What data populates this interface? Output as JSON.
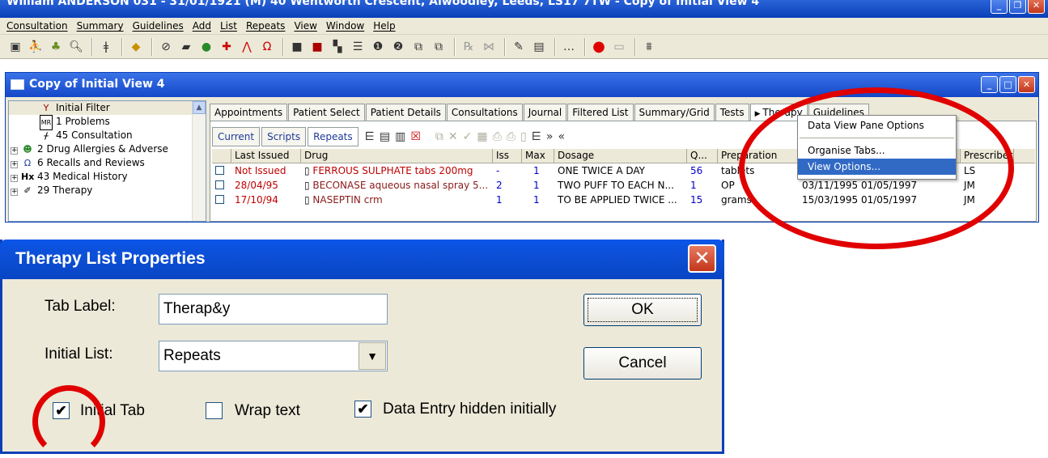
{
  "app": {
    "title": "William ANDERSON 031 - 31/01/1921 (M) 40 Wentworth Crescent, Alwoodley, Leeds, LS17 7TW - Copy of Initial View 4"
  },
  "menu": [
    "Consultation",
    "Summary",
    "Guidelines",
    "Add",
    "List",
    "Repeats",
    "View",
    "Window",
    "Help"
  ],
  "child_window": {
    "title": "Copy of Initial View 4",
    "tree": [
      {
        "label": "Initial Filter",
        "icon": "filter-icon"
      },
      {
        "label": "1 Problems",
        "icon": "problems-icon"
      },
      {
        "label": "45 Consultation",
        "icon": "consultation-icon"
      },
      {
        "label": "2 Drug Allergies & Adverse",
        "icon": "allergy-icon"
      },
      {
        "label": "6 Recalls and Reviews",
        "icon": "recall-icon"
      },
      {
        "label": "43 Medical History",
        "icon": "history-icon"
      },
      {
        "label": "29 Therapy",
        "icon": "therapy-icon"
      }
    ],
    "tabs": [
      "Appointments",
      "Patient Select",
      "Patient Details",
      "Consultations",
      "Journal",
      "Filtered List",
      "Summary/Grid",
      "Tests",
      "Therapy",
      "Guidelines"
    ],
    "subtabs": [
      "Current",
      "Scripts",
      "Repeats"
    ],
    "grid": {
      "headers": [
        "Last Issued",
        "Drug",
        "Iss",
        "Max",
        "Dosage",
        "Q...",
        "Preparation",
        "",
        "Prescriber"
      ],
      "rows": [
        {
          "last_issued": "Not Issued",
          "drug": "FERROUS SULPHATE tabs 200mg",
          "iss": "-",
          "max": "1",
          "dosage": "ONE TWICE A DAY",
          "q": "56",
          "prep": "tablets",
          "dates": "",
          "prescriber": "LS"
        },
        {
          "last_issued": "28/04/95",
          "drug": "BECONASE aqueous nasal spray 5...",
          "iss": "2",
          "max": "1",
          "dosage": "TWO PUFF TO EACH N...",
          "q": "1",
          "prep": "OP",
          "dates": "03/11/1995  01/05/1997",
          "prescriber": "JM"
        },
        {
          "last_issued": "17/10/94",
          "drug": "NASEPTIN crm",
          "iss": "1",
          "max": "1",
          "dosage": "TO BE APPLIED TWICE ...",
          "q": "15",
          "prep": "grams",
          "dates": "15/03/1995  01/05/1997",
          "prescriber": "JM"
        }
      ]
    }
  },
  "context_menu": {
    "items": [
      "Data View Pane Options",
      "Organise Tabs...",
      "View Options..."
    ]
  },
  "dialog": {
    "title": "Therapy List Properties",
    "tab_label_caption": "Tab Label:",
    "tab_label_value": "Therap&y",
    "initial_list_caption": "Initial List:",
    "initial_list_value": "Repeats",
    "ok": "OK",
    "cancel": "Cancel",
    "initial_tab": "Initial Tab",
    "wrap_text": "Wrap text",
    "data_entry_hidden": "Data Entry hidden initially",
    "initial_tab_checked": true,
    "wrap_text_checked": false,
    "data_entry_hidden_checked": true
  },
  "colors": {
    "annotation": "#e00000",
    "title_blue": "#0a3fb8",
    "menu_highlight": "#316ac5"
  }
}
